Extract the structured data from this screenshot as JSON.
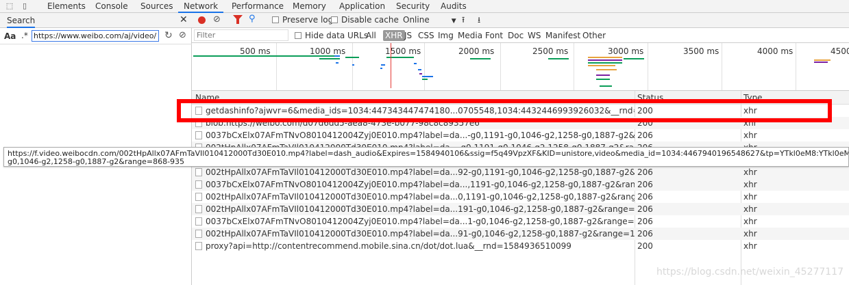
{
  "top_tabs": [
    "Elements",
    "Console",
    "Sources",
    "Network",
    "Performance",
    "Memory",
    "Application",
    "Security",
    "Audits"
  ],
  "active_tab": "Network",
  "search_panel": {
    "title": "Search",
    "aa_label": "Aa",
    "regex_label": ".*",
    "query": "https://www.weibo.com/aj/video/c"
  },
  "toolbar": {
    "preserve_log": "Preserve log",
    "disable_cache": "Disable cache",
    "throttle": "Online"
  },
  "filter": {
    "placeholder": "Filter",
    "hide_data_urls": "Hide data URLs",
    "types": [
      "All",
      "XHR",
      "JS",
      "CSS",
      "Img",
      "Media",
      "Font",
      "Doc",
      "WS",
      "Manifest",
      "Other"
    ],
    "selected": "XHR"
  },
  "timeline": {
    "ticks": [
      "500 ms",
      "1000 ms",
      "1500 ms",
      "2000 ms",
      "2500 ms",
      "3000 ms",
      "3500 ms",
      "4000 ms",
      "4500"
    ]
  },
  "table": {
    "headers": {
      "name": "Name",
      "status": "Status",
      "type": "Type"
    },
    "rows": [
      {
        "name": "getdashinfo?ajwvr=6&media_ids=1034:447343447474180...0705548,1034:4432446993926032&__rnd=15849365060...",
        "status": "200",
        "type": "xhr"
      },
      {
        "name": "blob:https://weibo.com/d07d6dd5-aea8-473e-b077-98c8c89357e6",
        "status": "200",
        "type": "xhr"
      },
      {
        "name": "0037bCxElx07AFmTNvO8010412004Zyj0E010.mp4?label=da...-g0,1191-g0,1046-g2,1258-g0,1887-g2&range=915-9...",
        "status": "206",
        "type": "xhr"
      },
      {
        "name": "002tHpAllx07AFmTaVIl010412000Td30E010.mp4?label=da...-g0,1191-g0,1046-g2,1258-g0,1887-g2&range=868-935",
        "status": "206",
        "type": "xhr"
      },
      {
        "name": "",
        "status": "",
        "type": ""
      },
      {
        "name": "",
        "status": "",
        "type": ""
      },
      {
        "name": "002tHpAllx07AFmTaVIl010412000Td30E010.mp4?label=da...92-g0,1191-g0,1046-g2,1258-g0,1887-g2&range=0-867",
        "status": "206",
        "type": "xhr"
      },
      {
        "name": "0037bCxElx07AFmTNvO8010412004Zyj0E010.mp4?label=da...,1191-g0,1046-g2,1258-g0,1887-g2&range=971-7830...",
        "status": "206",
        "type": "xhr"
      },
      {
        "name": "002tHpAllx07AFmTaVIl010412000Td30E010.mp4?label=da...0,1191-g0,1046-g2,1258-g0,1887-g2&range=936-80989",
        "status": "206",
        "type": "xhr"
      },
      {
        "name": "002tHpAllx07AFmTaVIl010412000Td30E010.mp4?label=da...191-g0,1046-g2,1258-g0,1887-g2&range=80990-161789",
        "status": "206",
        "type": "xhr"
      },
      {
        "name": "0037bCxElx07AFmTNvO8010412004Zyj0E010.mp4?label=da...1-g0,1046-g2,1258-g0,1887-g2&range=783060-1189...",
        "status": "206",
        "type": "xhr"
      },
      {
        "name": "002tHpAllx07AFmTaVIl010412000Td30E010.mp4?label=da...91-g0,1046-g2,1258-g0,1887-g2&range=161790-212228",
        "status": "206",
        "type": "xhr"
      },
      {
        "name": "proxy?api=http://contentrecommend.mobile.sina.cn/dot/dot.lua&__rnd=1584936510099",
        "status": "200",
        "type": "xhr"
      }
    ]
  },
  "tooltip": {
    "line1": "https://f.video.weibocdn.com/002tHpAllx07AFmTaVIl010412000Td30E010.mp4?label=dash_audio&Expires=1584940106&ssig=f5q49VpzXF&KID=unistore,video&media_id=1034:4467940196548627&tp=YTkl0eM8:YTkl0eM8&us=6jCv",
    "line2": "g0,1046-g2,1258-g0,1887-g2&range=868-935"
  },
  "watermark": "https://blog.csdn.net/weixin_45277117",
  "colors": {
    "accent": "#1a73e8",
    "record": "#d93025",
    "highlight": "#ff0000"
  }
}
